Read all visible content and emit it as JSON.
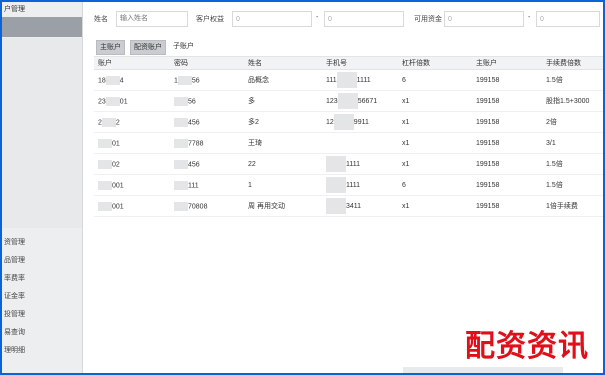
{
  "sidebar": {
    "top_label": "户管理",
    "items": [
      {
        "label": "资管理"
      },
      {
        "label": "品管理"
      },
      {
        "label": "率费率"
      },
      {
        "label": "证金率"
      },
      {
        "label": "投管理"
      },
      {
        "label": "易查询"
      },
      {
        "label": "理明细"
      }
    ]
  },
  "filters": {
    "name_label": "姓名",
    "name_placeholder": "输入姓名",
    "rights_label": "客户权益",
    "rights_min": "0",
    "rights_sep": "-",
    "rights_max": "0",
    "funds_label": "可用资金",
    "funds_min": "0",
    "funds_sep": "-",
    "funds_max": "0"
  },
  "tabs": [
    {
      "label": "主账户"
    },
    {
      "label": "配资账户"
    },
    {
      "label": "子账户"
    }
  ],
  "table": {
    "columns": [
      "账户",
      "密码",
      "姓名",
      "手机号",
      "杠杆倍数",
      "主账户",
      "手续费倍数"
    ],
    "rows": [
      {
        "account": "18",
        "account_tail": "4",
        "password": "1",
        "password_tail": "56",
        "name": "品概念",
        "phone": "111",
        "phone_tail": "1111",
        "leverage": "6",
        "main": "199158",
        "fee": "1.5倍"
      },
      {
        "account": "23",
        "account_tail": "01",
        "password": "",
        "password_tail": "56",
        "name": "多",
        "phone": "123",
        "phone_tail": "56671",
        "leverage": "x1",
        "main": "199158",
        "fee": "股指1.5+3000"
      },
      {
        "account": "2",
        "account_tail": "2",
        "password": "",
        "password_tail": "456",
        "name": "多2",
        "phone": "12",
        "phone_tail": "9911",
        "leverage": "x1",
        "main": "199158",
        "fee": "2倍"
      },
      {
        "account": "",
        "account_tail": "01",
        "password": "",
        "password_tail": "7788",
        "name": "王琦",
        "phone": "",
        "phone_tail": "",
        "leverage": "x1",
        "main": "199158",
        "fee": "3/1"
      },
      {
        "account": "",
        "account_tail": "02",
        "password": "",
        "password_tail": "456",
        "name": "22",
        "phone": "",
        "phone_tail": "1111",
        "leverage": "x1",
        "main": "199158",
        "fee": "1.5倍"
      },
      {
        "account": "",
        "account_tail": "001",
        "password": "",
        "password_tail": "111",
        "name": "1",
        "phone": "",
        "phone_tail": "1111",
        "leverage": "6",
        "main": "199158",
        "fee": "1.5倍"
      },
      {
        "account": "",
        "account_tail": "001",
        "password": "",
        "password_tail": "70808",
        "name": "周   再用交动",
        "phone": "",
        "phone_tail": "3411",
        "leverage": "x1",
        "main": "199158",
        "fee": "1倍手续费"
      }
    ]
  },
  "watermark": "配资资讯",
  "colors": {
    "border": "#0b63d9",
    "sidebar_bg": "#eceeef",
    "sidebar_active": "#9aa0a6",
    "watermark": "#e0101a"
  }
}
